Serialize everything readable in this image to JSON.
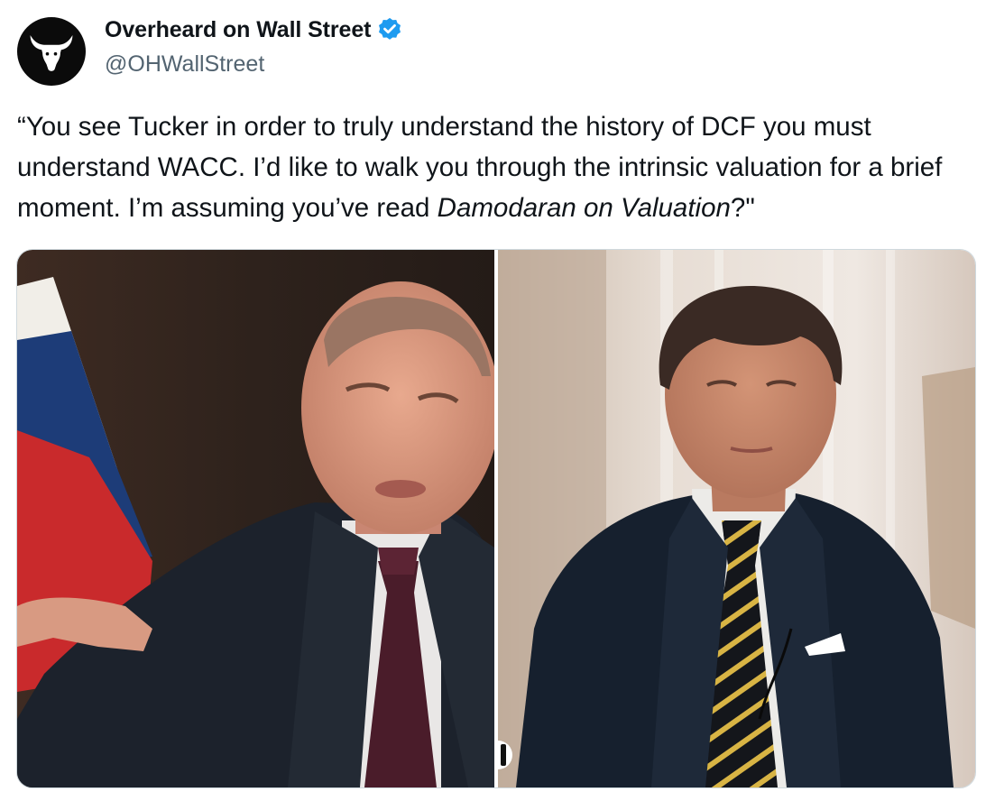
{
  "author": {
    "display_name": "Overheard on Wall Street",
    "handle": "@OHWallStreet",
    "verified": true,
    "avatar_icon": "bull-head-icon",
    "verified_icon": "verified-badge-icon",
    "verified_color": "#1d9bf0"
  },
  "tweet": {
    "text_before": "“You see Tucker in order to truly understand the history of DCF you must understand WACC. I’d like to walk you through the intrinsic valuation for a brief moment. I’m assuming you’ve read ",
    "text_italic": "Damodaran on Valuation",
    "text_after": "?\""
  },
  "media": {
    "images": [
      {
        "name": "left-interview-photo"
      },
      {
        "name": "right-interview-photo"
      }
    ]
  }
}
